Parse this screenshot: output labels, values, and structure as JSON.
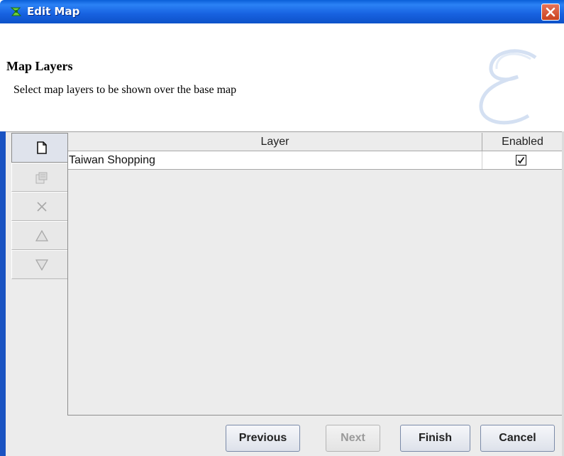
{
  "window": {
    "title": "Edit Map",
    "icons": {
      "app": "map-app-icon",
      "close": "close-icon"
    }
  },
  "header": {
    "title": "Map Layers",
    "subtitle": "Select map layers to be shown over the base map",
    "watermark_icon": "script-e-watermark-icon"
  },
  "toolbar": {
    "buttons": [
      {
        "icon": "new-layer-icon",
        "enabled": true
      },
      {
        "icon": "properties-icon",
        "enabled": false
      },
      {
        "icon": "delete-icon",
        "enabled": false
      },
      {
        "icon": "move-up-icon",
        "enabled": false
      },
      {
        "icon": "move-down-icon",
        "enabled": false
      }
    ]
  },
  "table": {
    "columns": [
      "Layer",
      "Enabled"
    ],
    "rows": [
      {
        "layer": "Taiwan Shopping",
        "enabled": true
      }
    ]
  },
  "footer": {
    "previous_label": "Previous",
    "next_label": "Next",
    "finish_label": "Finish",
    "cancel_label": "Cancel"
  },
  "colors": {
    "titlebar": "#1761e0",
    "close_button": "#d9532f",
    "panel_bg": "#ececec"
  }
}
